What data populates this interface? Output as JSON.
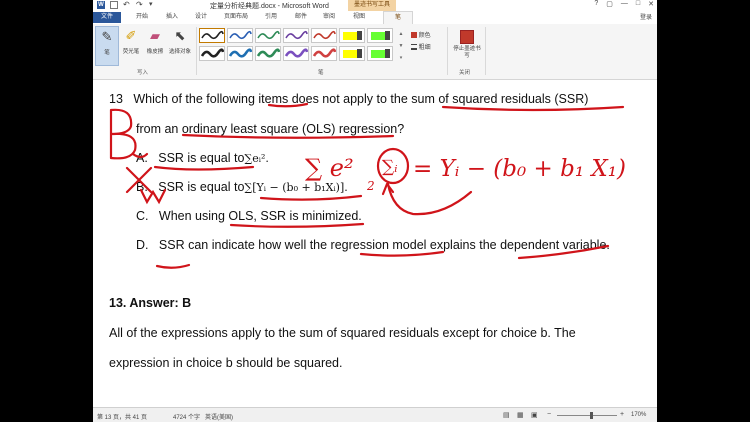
{
  "window": {
    "title": "定量分析经典题.docx - Microsoft Word",
    "contextual_tools": "墨迹书写工具",
    "controls": [
      "?",
      "▢",
      "—",
      "□",
      "✕"
    ]
  },
  "tabs": {
    "items": [
      "文件",
      "开始",
      "插入",
      "设计",
      "页面布局",
      "引用",
      "邮件",
      "审阅",
      "视图",
      "笔"
    ],
    "active": "笔",
    "user": "登录"
  },
  "ribbon": {
    "write_group": {
      "buttons": [
        "笔",
        "荧光笔",
        "橡皮擦",
        "选择对象"
      ],
      "label": "写入"
    },
    "pens_group": {
      "label": "笔",
      "color_label": "颜色",
      "thickness_label": "粗细"
    },
    "close_group": {
      "stop_label": "停止墨迹书写",
      "label": "关闭"
    },
    "pen_colors": [
      "#222222",
      "#2b5fb4",
      "#2e8b57",
      "#6a3fa0",
      "#c0392b",
      "#222222",
      "#1f6fb2",
      "#2e8b57",
      "#7a4fbf",
      "#d04040"
    ],
    "highlighter_colors": [
      "#ffff00",
      "#66ff33",
      "#ffff00",
      "#66ff33"
    ]
  },
  "document": {
    "question_number": "13",
    "question_line1": "Which of the following items does not apply to the sum of squared residuals (SSR)",
    "question_line2": "from an ordinary least square (OLS) regression?",
    "option_a_letter": "A.",
    "option_a_text": "SSR is equal to",
    "option_a_math": "∑eᵢ².",
    "option_b_letter": "B.",
    "option_b_text": "SSR is equal to",
    "option_b_math": "∑[Yᵢ − (b₀ + b₁Xᵢ)].",
    "option_c_letter": "C.",
    "option_c_text": "When using OLS, SSR is minimized.",
    "option_d_letter": "D.",
    "option_d_text": "SSR can indicate how well the regression model explains the dependent variable.",
    "answer_heading": "13.   Answer: B",
    "explanation_line1": "All of the expressions apply to the sum of squared residuals except for choice b. The",
    "explanation_line2": "expression in choice b should be squared.",
    "handwriting": {
      "big_letter": "B",
      "sum_e2": "∑ e²",
      "exponent": "2",
      "formula": "= Yᵢ − (b₀ + b₁ X₁)",
      "circled": "∑ᵢ",
      "cross_marks": "X w"
    }
  },
  "status": {
    "page": "第 13 页，共 41 页",
    "words": "4724 个字",
    "language": "英语(美国)",
    "zoom": "170%"
  }
}
